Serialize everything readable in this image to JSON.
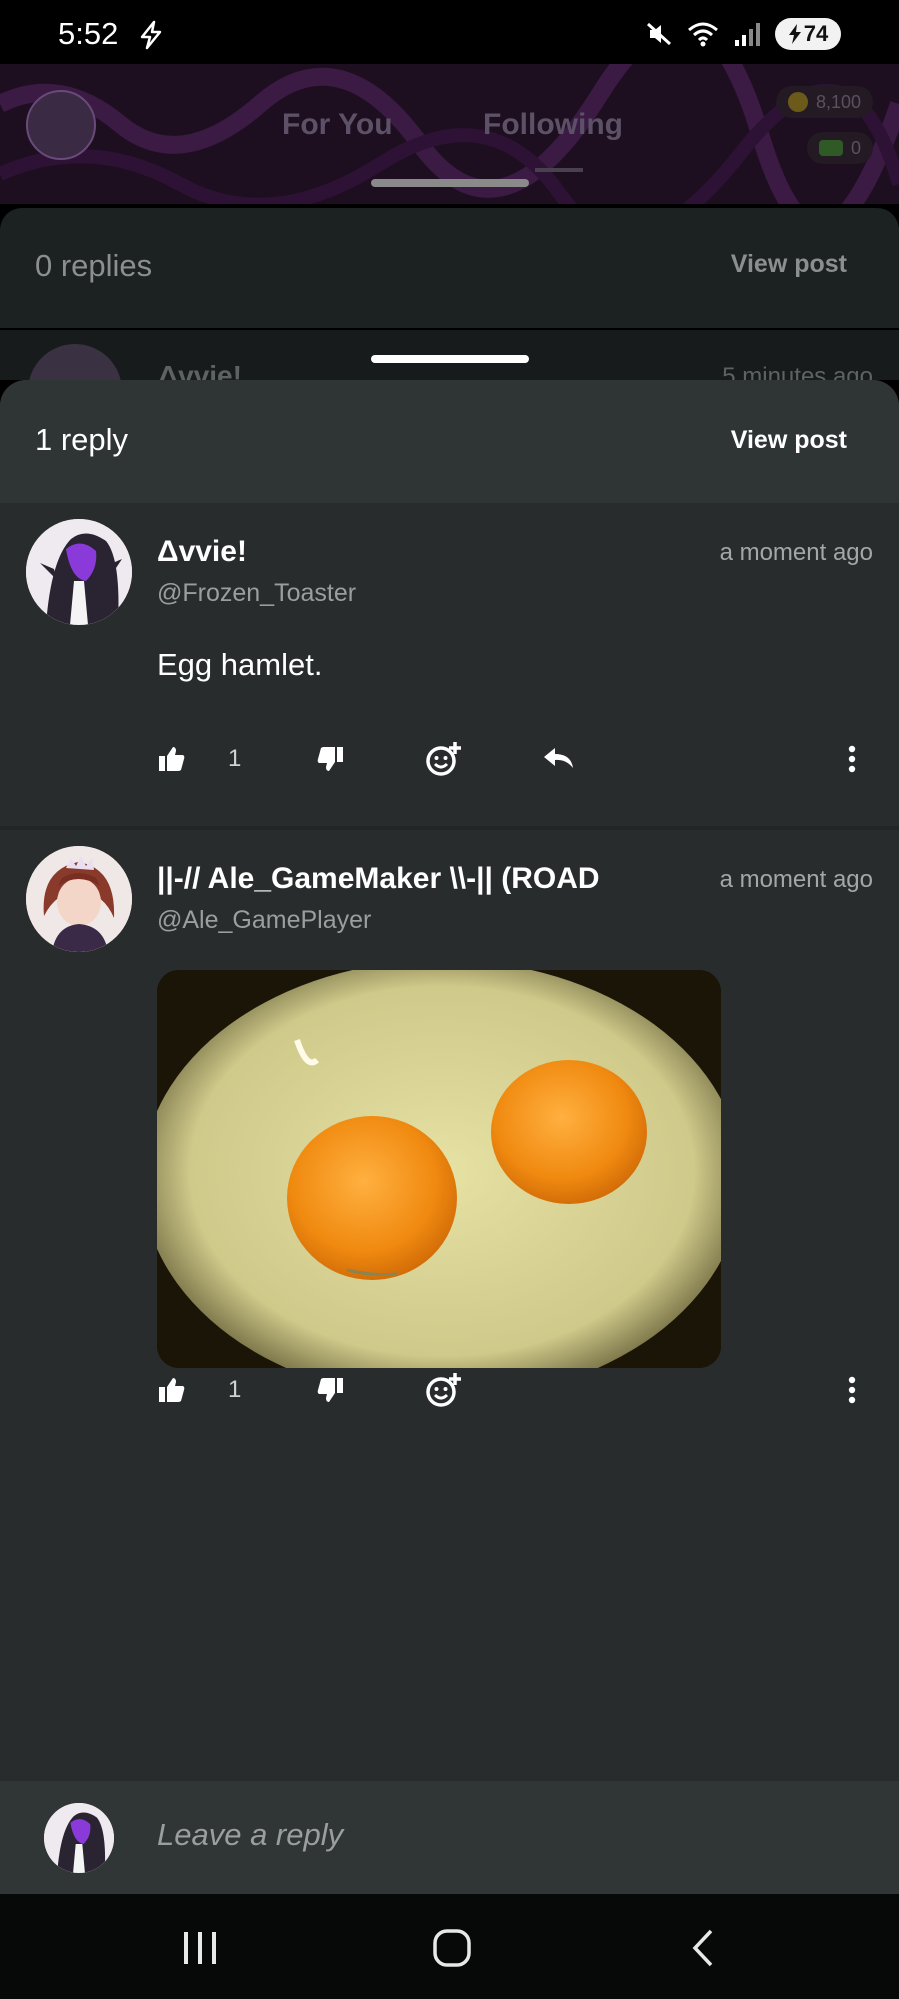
{
  "status_bar": {
    "time": "5:52",
    "battery": "74"
  },
  "background_app": {
    "tabs": [
      {
        "label": "For You"
      },
      {
        "label": "Following"
      }
    ],
    "coins": "8,100",
    "cash": "0"
  },
  "back_sheet": {
    "title": "0 replies",
    "view_post": "View post",
    "peek_name": "Δvvie!",
    "peek_time": "5 minutes ago"
  },
  "sheet": {
    "title": "1 reply",
    "view_post": "View post"
  },
  "comments": [
    {
      "name": "Δvvie!",
      "handle": "@Frozen_Toaster",
      "time": "a moment ago",
      "text": "Egg hamlet.",
      "likes": "1"
    },
    {
      "name": "||-// Ale_GameMaker \\\\-|| (ROAD",
      "handle": "@Ale_GamePlayer",
      "time": "a moment ago",
      "likes": "1"
    }
  ],
  "reply_bar": {
    "placeholder": "Leave a reply"
  },
  "colors": {
    "sheet_bg": "#282c2c",
    "header_bg": "#2f3434",
    "accent_purple": "#7a2ed1",
    "yolk": "#f08a10"
  },
  "icons": {
    "like": "thumbs-up-icon",
    "dislike": "thumbs-down-icon",
    "react": "add-reaction-icon",
    "reply": "reply-arrow-icon",
    "more": "more-vertical-icon"
  }
}
